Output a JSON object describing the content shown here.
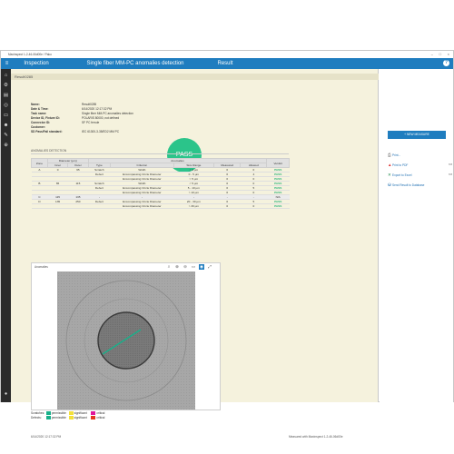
{
  "window": {
    "title": "Maxinspect 1-2-46-06d00e / Pako"
  },
  "topbar": {
    "tabs": [
      "Inspection",
      "Single fiber MM-PC anomalies detection",
      "Result"
    ],
    "help": "?"
  },
  "result_header": "Result0285",
  "info": [
    {
      "label": "Name:",
      "value": "Result0285"
    },
    {
      "label": "Date & Time:",
      "value": "6/14/2020 12:17:32 PM"
    },
    {
      "label": "Task name:",
      "value": "Single fiber MM-PC anomalies detection"
    },
    {
      "label": "Device ID, Fixture ID:",
      "value": "POLARIS 80000, not defined"
    },
    {
      "label": "Connector ID:",
      "value": "SF PC ferrule"
    },
    {
      "label": "Customer:",
      "value": ""
    },
    {
      "label": "SD Pass/Fail standard:",
      "value": "IEC 61300-3-35/ED2 MM PC"
    }
  ],
  "pass_badge": "PASS",
  "anomalies_title": "ANOMALIES DETECTION",
  "table": {
    "group_headers": {
      "diameter": "Diameter (µm)",
      "anomalies": "Anomalies"
    },
    "headers": [
      "Zone",
      "Inner",
      "Outer",
      "Type",
      "Criterion",
      "Size Range",
      "Measured",
      "Allowed",
      "Verdict"
    ],
    "rows": [
      [
        "A",
        "0",
        "65",
        "Scratch",
        "Width",
        "< 3 µm",
        "0",
        "0",
        "PASS"
      ],
      [
        "",
        "",
        "",
        "Defect",
        "Encompassing Circle Diameter",
        "0 - 5 µm",
        "0",
        "4",
        "PASS"
      ],
      [
        "",
        "",
        "",
        "",
        "Encompassing Circle Diameter",
        "> 5 µm",
        "0",
        "0",
        "PASS"
      ],
      [
        "B",
        "65",
        "115",
        "Scratch",
        "Width",
        "< 5 µm",
        "0",
        "0",
        "PASS"
      ],
      [
        "",
        "",
        "",
        "Defect",
        "Encompassing Circle Diameter",
        "5 - 10 µm",
        "0",
        "5",
        "PASS"
      ],
      [
        "",
        "",
        "",
        "",
        "Encompassing Circle Diameter",
        "> 10 µm",
        "0",
        "0",
        "PASS"
      ],
      [
        "C",
        "115",
        "135",
        "-",
        "-",
        "-",
        "-",
        "-",
        "N/A"
      ],
      [
        "D",
        "135",
        "250",
        "Defect",
        "Encompassing Circle Diameter",
        "20 - 30 µm",
        "0",
        "5",
        "PASS"
      ],
      [
        "",
        "",
        "",
        "",
        "Encompassing Circle Diameter",
        "> 30 µm",
        "0",
        "0",
        "PASS"
      ]
    ]
  },
  "image_panel": {
    "title": "Anomalies"
  },
  "legend": {
    "scratches_label": "Scratches:",
    "defects_label": "Defects:",
    "items": [
      "permissible",
      "significant",
      "critical"
    ],
    "colors": {
      "permissible": "#18b08a",
      "significant": "#f3e03a",
      "critical_scratch": "#e0149b",
      "critical_defect": "#e5341f"
    }
  },
  "footer": {
    "date": "6/14/2020 12:17:32 PM",
    "measured_with": "Measured with Maxinspect 1-2-46-06d00e"
  },
  "right_panel": {
    "new_measure": "+ NEW MEASURE",
    "actions": [
      "Print...",
      "Print to PDF",
      "Export to Excel",
      "Send Result to Database"
    ]
  }
}
